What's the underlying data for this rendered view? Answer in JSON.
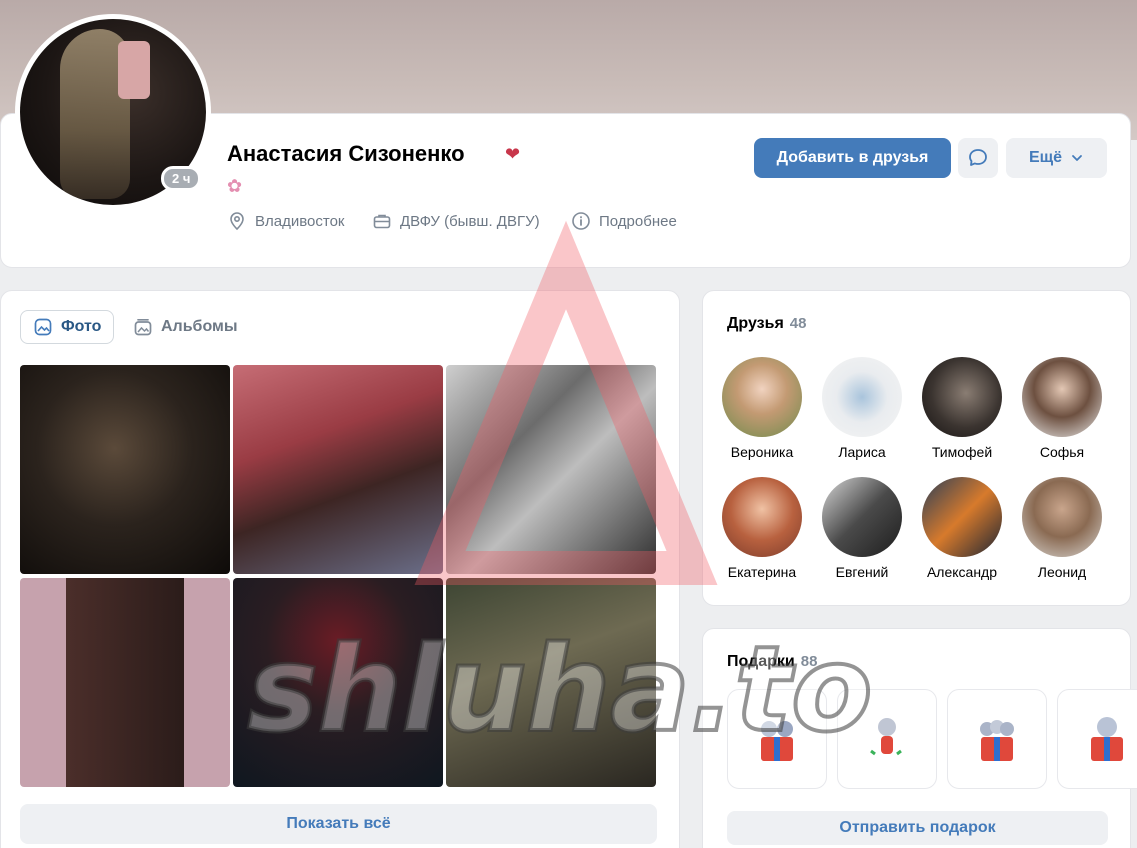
{
  "profile": {
    "name": "Анастасия Сизоненко",
    "name_emoji": "❤",
    "status_emoji": "✿",
    "last_seen": "2 ч",
    "city": "Владивосток",
    "university": "ДВФУ (бывш. ДВГУ)",
    "details_label": "Подробнее"
  },
  "actions": {
    "add_friend": "Добавить в друзья",
    "more": "Ещё"
  },
  "photos": {
    "tabs": [
      {
        "label": "Фото",
        "active": true
      },
      {
        "label": "Альбомы",
        "active": false
      }
    ],
    "show_all": "Показать всё"
  },
  "friends": {
    "title": "Друзья",
    "count": "48",
    "items": [
      {
        "name": "Вероника"
      },
      {
        "name": "Лариса"
      },
      {
        "name": "Тимофей"
      },
      {
        "name": "Софья"
      },
      {
        "name": "Екатерина"
      },
      {
        "name": "Евгений"
      },
      {
        "name": "Александр"
      },
      {
        "name": "Леонид"
      }
    ]
  },
  "gifts": {
    "title": "Подарки",
    "count": "88",
    "send_label": "Отправить подарок"
  },
  "watermark": {
    "text": "shluha.to"
  },
  "colors": {
    "accent": "#447bba",
    "background": "#edeef0",
    "muted_text": "#6d7885"
  }
}
